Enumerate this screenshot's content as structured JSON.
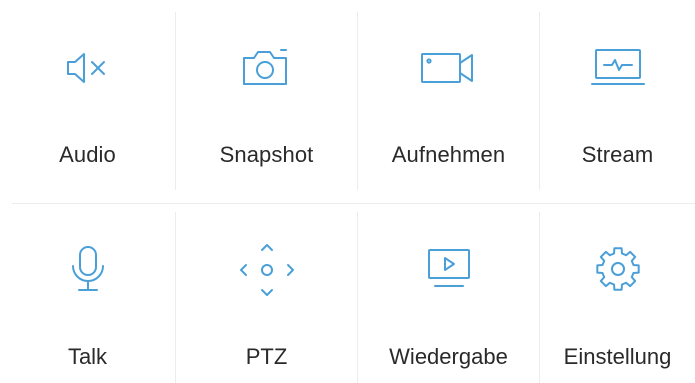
{
  "theme": {
    "accent": "#4a9fd8",
    "text": "#2a2a2a",
    "divider": "#ececec"
  },
  "menu": {
    "items": [
      {
        "label": "Audio",
        "icon": "speaker-mute-icon"
      },
      {
        "label": "Snapshot",
        "icon": "camera-icon"
      },
      {
        "label": "Aufnehmen",
        "icon": "video-camera-icon"
      },
      {
        "label": "Stream",
        "icon": "monitor-pulse-icon"
      },
      {
        "label": "Talk",
        "icon": "microphone-icon"
      },
      {
        "label": "PTZ",
        "icon": "ptz-arrows-icon"
      },
      {
        "label": "Wiedergabe",
        "icon": "playback-monitor-icon"
      },
      {
        "label": "Einstellung",
        "icon": "gear-icon"
      }
    ]
  }
}
